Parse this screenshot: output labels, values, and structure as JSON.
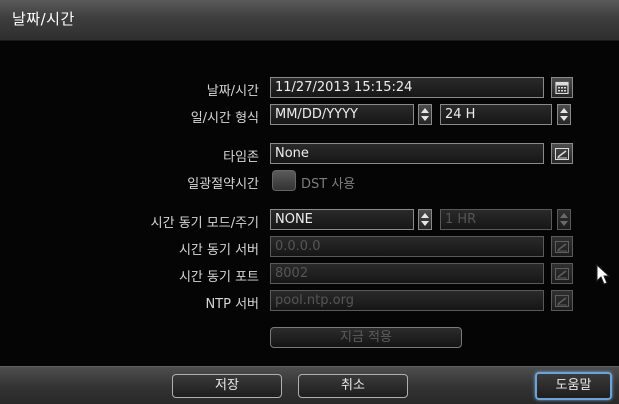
{
  "window": {
    "title": "날짜/시간"
  },
  "form": {
    "date_time": {
      "label": "날짜/시간",
      "value": "11/27/2013 15:15:24"
    },
    "format": {
      "label": "일/시간 형식",
      "date_format": "MM/DD/YYYY",
      "time_format": "24 H"
    },
    "timezone": {
      "label": "타임존",
      "value": "None"
    },
    "dst": {
      "label": "일광절약시간",
      "checkbox_label": "DST 사용",
      "checked": false
    },
    "sync_mode": {
      "label": "시간 동기 모드/주기",
      "mode": "NONE",
      "period": "1 HR"
    },
    "sync_server": {
      "label": "시간 동기 서버",
      "value": "0.0.0.0"
    },
    "sync_port": {
      "label": "시간 동기 포트",
      "value": "8002"
    },
    "ntp_server": {
      "label": "NTP 서버",
      "value": "pool.ntp.org"
    },
    "apply_now": {
      "label": "지금 적용"
    }
  },
  "footer": {
    "save": "저장",
    "cancel": "취소",
    "help": "도움말"
  },
  "colors": {
    "help_highlight": "#6fa3d6",
    "disabled_text": "#555555"
  },
  "icons": {
    "calendar": "calendar-icon",
    "edit": "edit-icon",
    "spin": "up-down-spin-icon",
    "cursor": "mouse-pointer-icon"
  }
}
